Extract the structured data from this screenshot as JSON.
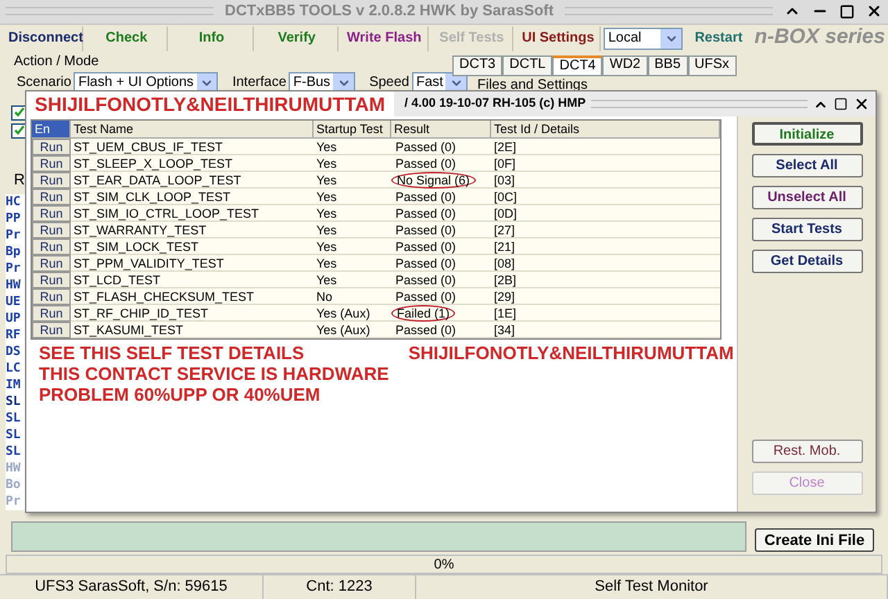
{
  "window": {
    "title": "DCTxBB5 TOOLS v 2.0.8.2 HWK by SarasSoft"
  },
  "toolbar": [
    {
      "label": "Disconnect",
      "color": "#1a2a6c"
    },
    {
      "label": "Check",
      "color": "#1d7a1d"
    },
    {
      "label": "Info",
      "color": "#1d7a1d"
    },
    {
      "label": "Verify",
      "color": "#1d7a1d"
    },
    {
      "label": "Write Flash",
      "color": "#8a1f8a"
    },
    {
      "label": "Self Tests",
      "color": "#b0b0b0"
    },
    {
      "label": "UI Settings",
      "color": "#8a1a1a"
    }
  ],
  "mode_select": {
    "value": "Local"
  },
  "restart": {
    "label": "Restart"
  },
  "logo": "n-BOX series",
  "action_mode": {
    "title": "Action / Mode",
    "scenario_label": "Scenario",
    "scenario": "Flash + UI Options",
    "interface_label": "Interface",
    "interface": "F-Bus",
    "speed_label": "Speed",
    "speed": "Fast"
  },
  "side_checkboxes": [
    {
      "checked": true
    },
    {
      "checked": true
    }
  ],
  "side_label": "R",
  "side_list": [
    "HC",
    "PP",
    "Pr",
    "Bp",
    "Pr",
    "HW",
    "UE",
    "UP",
    "RF",
    "DS",
    "LC",
    "IM",
    "SL",
    "SL",
    "SL",
    "SL",
    "HW",
    "Bo",
    "Pr"
  ],
  "tabs": [
    {
      "label": "DCT3",
      "selected": false
    },
    {
      "label": "DCTL",
      "selected": false
    },
    {
      "label": "DCT4",
      "selected": true
    },
    {
      "label": "WD2",
      "selected": false
    },
    {
      "label": "BB5",
      "selected": false
    },
    {
      "label": "UFSx",
      "selected": false
    }
  ],
  "files_group": "Files and Settings",
  "dialog": {
    "title": "/ 4.00 19-10-07 RH-105 (c) HMP",
    "columns": [
      "En",
      "Test Name",
      "Startup Test",
      "Result",
      "Test Id / Details"
    ],
    "rows": [
      {
        "run": "Run",
        "name": "ST_UEM_CBUS_IF_TEST",
        "startup": "Yes",
        "result": "Passed (0)",
        "id": "[2E]",
        "circled": false
      },
      {
        "run": "Run",
        "name": "ST_SLEEP_X_LOOP_TEST",
        "startup": "Yes",
        "result": "Passed (0)",
        "id": "[0F]",
        "circled": false
      },
      {
        "run": "Run",
        "name": "ST_EAR_DATA_LOOP_TEST",
        "startup": "Yes",
        "result": "No Signal (6)",
        "id": "[03]",
        "circled": true
      },
      {
        "run": "Run",
        "name": "ST_SIM_CLK_LOOP_TEST",
        "startup": "Yes",
        "result": "Passed (0)",
        "id": "[0C]",
        "circled": false
      },
      {
        "run": "Run",
        "name": "ST_SIM_IO_CTRL_LOOP_TEST",
        "startup": "Yes",
        "result": "Passed (0)",
        "id": "[0D]",
        "circled": false
      },
      {
        "run": "Run",
        "name": "ST_WARRANTY_TEST",
        "startup": "Yes",
        "result": "Passed (0)",
        "id": "[27]",
        "circled": false
      },
      {
        "run": "Run",
        "name": "ST_SIM_LOCK_TEST",
        "startup": "Yes",
        "result": "Passed (0)",
        "id": "[21]",
        "circled": false
      },
      {
        "run": "Run",
        "name": "ST_PPM_VALIDITY_TEST",
        "startup": "Yes",
        "result": "Passed (0)",
        "id": "[08]",
        "circled": false
      },
      {
        "run": "Run",
        "name": "ST_LCD_TEST",
        "startup": "Yes",
        "result": "Passed (0)",
        "id": "[2B]",
        "circled": false
      },
      {
        "run": "Run",
        "name": "ST_FLASH_CHECKSUM_TEST",
        "startup": "No",
        "result": "Passed (0)",
        "id": "[29]",
        "circled": false
      },
      {
        "run": "Run",
        "name": "ST_RF_CHIP_ID_TEST",
        "startup": "Yes (Aux)",
        "result": "Failed (1)",
        "id": "[1E]",
        "circled": true
      },
      {
        "run": "Run",
        "name": "ST_KASUMI_TEST",
        "startup": "Yes (Aux)",
        "result": "Passed (0)",
        "id": "[34]",
        "circled": false
      }
    ],
    "buttons": [
      {
        "label": "Initialize",
        "color": "#1d7a1d",
        "disabled": false,
        "default": true
      },
      {
        "label": "Select All",
        "color": "#1a2a6c",
        "disabled": false,
        "default": false
      },
      {
        "label": "Unselect All",
        "color": "#6a1f6a",
        "disabled": false,
        "default": false
      },
      {
        "label": "Start Tests",
        "color": "#1a2a6c",
        "disabled": false,
        "default": false
      },
      {
        "label": "Get Details",
        "color": "#1a2a6c",
        "disabled": false,
        "default": false
      }
    ],
    "bottom_buttons": [
      {
        "label": "Rest. Mob.",
        "color": "#7a2a3a",
        "disabled": false
      },
      {
        "label": "Close",
        "color": "#c080d0",
        "disabled": true
      }
    ]
  },
  "annotation": {
    "header": "SHIJILFONOTLY&NEILTHIRUMUTTAM",
    "lines": [
      "SEE THIS SELF TEST DETAILS",
      "THIS CONTACT SERVICE IS HARDWARE",
      "PROBLEM 60%UPP OR 40%UEM"
    ],
    "signature": "SHIJILFONOTLY&NEILTHIRUMUTTAM"
  },
  "create_ini": {
    "label": "Create Ini File"
  },
  "progress": {
    "level": 0,
    "reading": "0%"
  },
  "status_bar": [
    "UFS3 SarasSoft, S/n: 59615",
    "Cnt: 1223",
    "Self Test Monitor"
  ]
}
